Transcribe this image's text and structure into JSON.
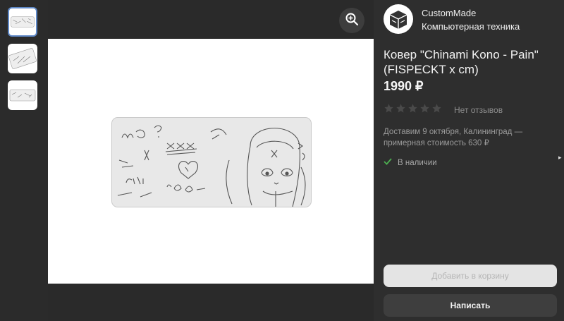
{
  "seller": {
    "name": "CustomMade",
    "category": "Компьютерная техника"
  },
  "product": {
    "title": "Ковер \"Chinami Kono - Pain\" (FISPECKT x cm)",
    "price": "1990 ₽",
    "rating_stars": 0,
    "reviews": "Нет отзывов",
    "delivery": "Доставим 9 октября, Калининград — примерная стоимость 630 ₽",
    "stock": "В наличии"
  },
  "buttons": {
    "add_to_cart": "Добавить в корзину",
    "write": "Написать"
  },
  "gallery": {
    "thumb_count": 3,
    "selected_index": 0
  },
  "colors": {
    "panel_bg": "#2e2e2e",
    "accent_check": "#4caf50",
    "thumb_selected_border": "#5f89c8"
  }
}
